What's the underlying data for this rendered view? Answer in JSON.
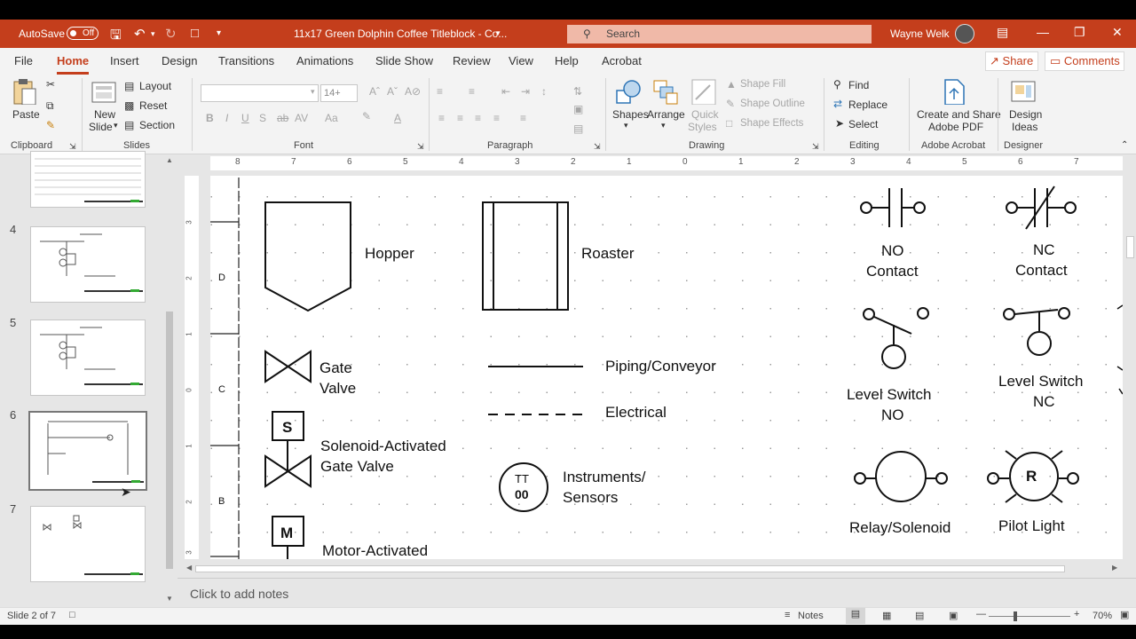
{
  "titlebar": {
    "autosave_label": "AutoSave",
    "autosave_state": "Off",
    "doc_title": "11x17 Green Dolphin Coffee Titleblock - Co...",
    "search_placeholder": "Search",
    "user_name": "Wayne Welk",
    "accent_color": "#c43e1c"
  },
  "tabs": [
    "File",
    "Home",
    "Insert",
    "Design",
    "Transitions",
    "Animations",
    "Slide Show",
    "Review",
    "View",
    "Help",
    "Acrobat"
  ],
  "active_tab": "Home",
  "share_label": "Share",
  "comments_label": "Comments",
  "ribbon": {
    "clipboard": {
      "label": "Clipboard",
      "paste": "Paste"
    },
    "slides": {
      "label": "Slides",
      "new_slide_1": "New",
      "new_slide_2": "Slide",
      "layout": "Layout",
      "reset": "Reset",
      "section": "Section"
    },
    "font": {
      "label": "Font",
      "size": "14+"
    },
    "paragraph": {
      "label": "Paragraph"
    },
    "drawing": {
      "label": "Drawing",
      "shapes": "Shapes",
      "arrange": "Arrange",
      "quick_styles_1": "Quick",
      "quick_styles_2": "Styles",
      "shape_fill": "Shape Fill",
      "shape_outline": "Shape Outline",
      "shape_effects": "Shape Effects"
    },
    "editing": {
      "label": "Editing",
      "find": "Find",
      "replace": "Replace",
      "select": "Select"
    },
    "acrobat": {
      "label": "Adobe Acrobat",
      "create_1": "Create and Share",
      "create_2": "Adobe PDF"
    },
    "designer": {
      "label": "Designer",
      "ideas_1": "Design",
      "ideas_2": "Ideas"
    }
  },
  "thumbnails": [
    {
      "num": ""
    },
    {
      "num": "4"
    },
    {
      "num": "5"
    },
    {
      "num": "6"
    },
    {
      "num": "7"
    }
  ],
  "ruler_h": [
    "8",
    "7",
    "6",
    "5",
    "4",
    "3",
    "2",
    "1",
    "0",
    "1",
    "2",
    "3",
    "4",
    "5",
    "6",
    "7"
  ],
  "ruler_v": [
    "3",
    "2",
    "1",
    "0",
    "1",
    "2",
    "3"
  ],
  "zone_letters": [
    "D",
    "C",
    "B"
  ],
  "slide": {
    "hopper": "Hopper",
    "roaster": "Roaster",
    "gate_valve_1": "Gate",
    "gate_valve_2": "Valve",
    "piping": "Piping/Conveyor",
    "electrical": "Electrical",
    "solenoid_letter": "S",
    "solenoid_1": "Solenoid-Activated",
    "solenoid_2": "Gate Valve",
    "instr_tag_1": "TT",
    "instr_tag_2": "00",
    "instruments_1": "Instruments/",
    "instruments_2": "Sensors",
    "motor_letter": "M",
    "motor": "Motor-Activated",
    "no_contact_1": "NO",
    "no_contact_2": "Contact",
    "nc_contact_1": "NC",
    "nc_contact_2": "Contact",
    "level_no_1": "Level Switch",
    "level_no_2": "NO",
    "level_nc_1": "Level Switch",
    "level_nc_2": "NC",
    "relay": "Relay/Solenoid",
    "pilot_letter": "R",
    "pilot": "Pilot Light"
  },
  "notes_placeholder": "Click to add notes",
  "status": {
    "slide_info": "Slide 2 of 7",
    "notes": "Notes",
    "zoom": "70%"
  }
}
